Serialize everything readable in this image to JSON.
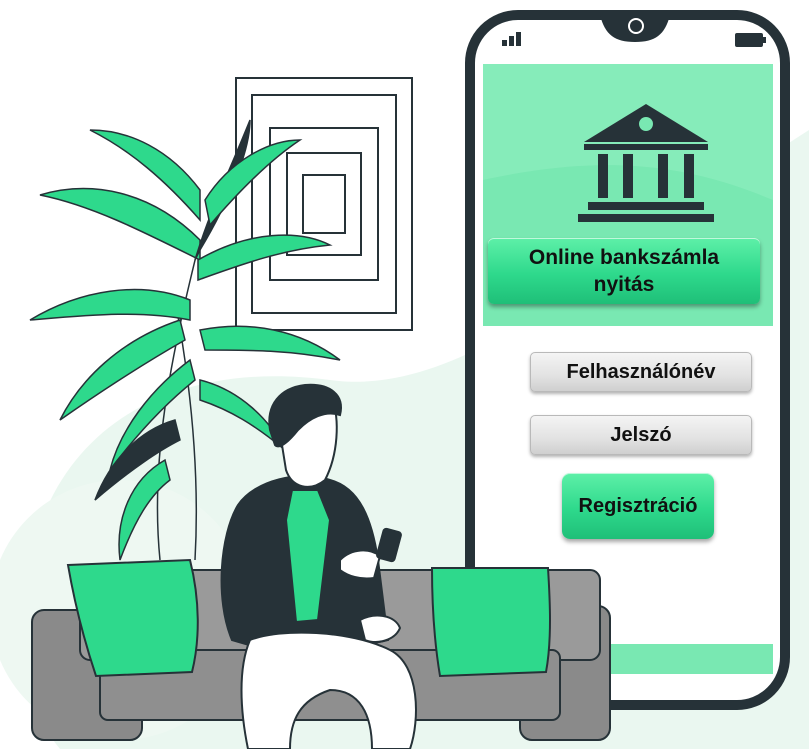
{
  "app": {
    "title_line1": "Online bankszámla",
    "title_line2": "nyitás"
  },
  "form": {
    "username_label": "Felhasználónév",
    "password_label": "Jelszó",
    "register_label": "Regisztráció"
  },
  "icons": [
    "signal-icon",
    "battery-icon",
    "camera-icon",
    "bank-icon"
  ],
  "colors": {
    "accent": "#2ed98c",
    "phone_frame": "#263238",
    "background_tint": "#eaf7f0",
    "sofa": "#8a8a8a"
  }
}
